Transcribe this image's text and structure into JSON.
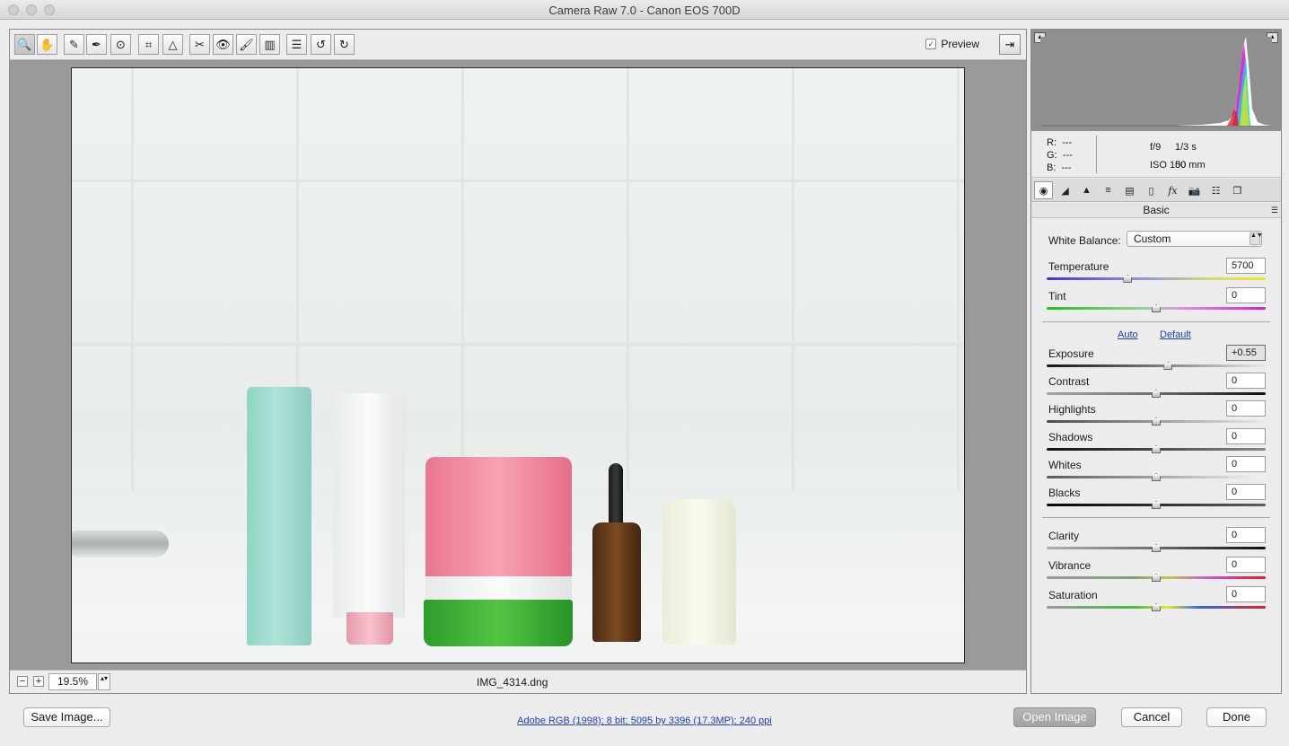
{
  "window": {
    "title": "Camera Raw 7.0  -  Canon EOS 700D"
  },
  "toolbar": {
    "tools": [
      {
        "name": "zoom-tool",
        "glyph": "🔍"
      },
      {
        "name": "hand-tool",
        "glyph": "✋"
      },
      {
        "name": "white-balance-tool",
        "glyph": "✎"
      },
      {
        "name": "color-sampler-tool",
        "glyph": "✒"
      },
      {
        "name": "targeted-adjustment-tool",
        "glyph": "⊙"
      },
      {
        "name": "crop-tool",
        "glyph": "⌗"
      },
      {
        "name": "straighten-tool",
        "glyph": "△"
      },
      {
        "name": "spot-removal-tool",
        "glyph": "✂"
      },
      {
        "name": "red-eye-removal-tool",
        "glyph": "👁"
      },
      {
        "name": "adjustment-brush-tool",
        "glyph": "🖌"
      },
      {
        "name": "graduated-filter-tool",
        "glyph": "▥"
      },
      {
        "name": "preferences-tool",
        "glyph": "☰"
      },
      {
        "name": "rotate-left-tool",
        "glyph": "↺"
      },
      {
        "name": "rotate-right-tool",
        "glyph": "↻"
      }
    ],
    "preview_label": "Preview",
    "preview_checked": "✓",
    "fullscreen_glyph": "⇥"
  },
  "image": {
    "filename": "IMG_4314.dng"
  },
  "zoom": {
    "minus": "−",
    "plus": "+",
    "value": "19.5%",
    "stepper": "▴▾"
  },
  "histogram": {
    "corner_glyph": "▲"
  },
  "info": {
    "r_label": "R:",
    "r_value": "---",
    "g_label": "G:",
    "g_value": "---",
    "b_label": "B:",
    "b_value": "---",
    "aperture": "f/9",
    "shutter": "1/3 s",
    "iso": "ISO 100",
    "focal_length": "50 mm"
  },
  "tabs": [
    {
      "name": "basic-tab",
      "glyph": "◉"
    },
    {
      "name": "tone-curve-tab",
      "glyph": "◢"
    },
    {
      "name": "detail-tab",
      "glyph": "▲"
    },
    {
      "name": "hsl-tab",
      "glyph": "≡"
    },
    {
      "name": "split-toning-tab",
      "glyph": "▤"
    },
    {
      "name": "lens-corrections-tab",
      "glyph": "▯"
    },
    {
      "name": "effects-tab",
      "glyph": "fx"
    },
    {
      "name": "camera-calibration-tab",
      "glyph": "📷"
    },
    {
      "name": "presets-tab",
      "glyph": "☷"
    },
    {
      "name": "snapshots-tab",
      "glyph": "❐"
    }
  ],
  "panel": {
    "title": "Basic",
    "menu_glyph": "☰"
  },
  "white_balance": {
    "label": "White Balance:",
    "value": "Custom",
    "arrow": "▲▼"
  },
  "sliders": {
    "temperature": {
      "label": "Temperature",
      "value": "5700",
      "level": 0.37
    },
    "tint": {
      "label": "Tint",
      "value": "0",
      "level": 0.5
    },
    "exposure": {
      "label": "Exposure",
      "value": "+0.55",
      "level": 0.555
    },
    "contrast": {
      "label": "Contrast",
      "value": "0",
      "level": 0.5
    },
    "highlights": {
      "label": "Highlights",
      "value": "0",
      "level": 0.5
    },
    "shadows": {
      "label": "Shadows",
      "value": "0",
      "level": 0.5
    },
    "whites": {
      "label": "Whites",
      "value": "0",
      "level": 0.5
    },
    "blacks": {
      "label": "Blacks",
      "value": "0",
      "level": 0.5
    },
    "clarity": {
      "label": "Clarity",
      "value": "0",
      "level": 0.5
    },
    "vibrance": {
      "label": "Vibrance",
      "value": "0",
      "level": 0.5
    },
    "saturation": {
      "label": "Saturation",
      "value": "0",
      "level": 0.5
    }
  },
  "auto_label": "Auto",
  "default_label": "Default",
  "footer": {
    "save_image": "Save Image...",
    "workflow": "Adobe RGB (1998); 8 bit; 5095 by 3396 (17.3MP); 240 ppi",
    "open_image": "Open Image",
    "cancel": "Cancel",
    "done": "Done"
  }
}
